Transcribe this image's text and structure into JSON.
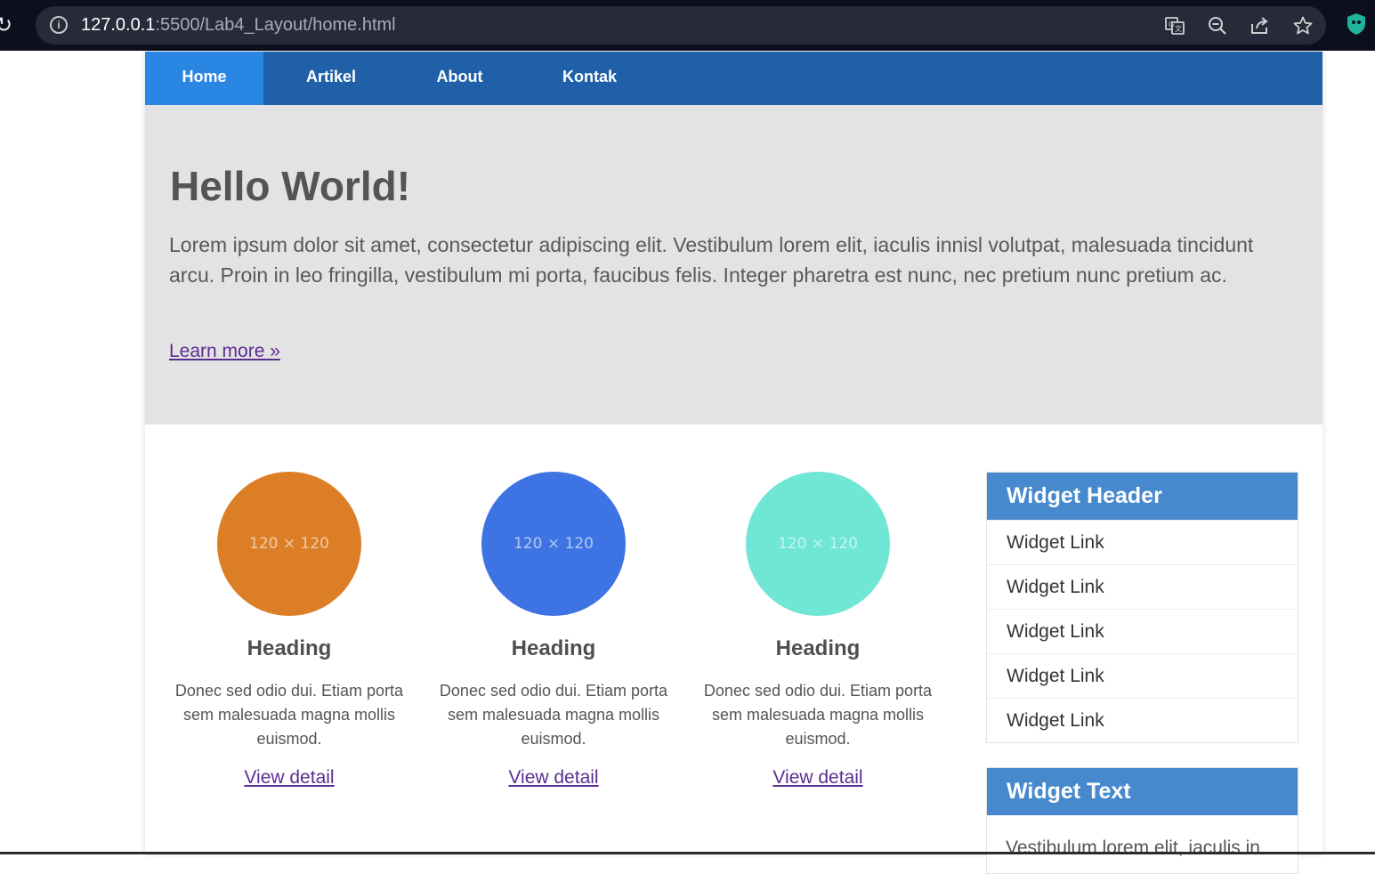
{
  "browser": {
    "url_host": "127.0.0.1",
    "url_path": ":5500/Lab4_Layout/home.html",
    "icons": [
      "reload-icon",
      "info-icon",
      "translate-icon",
      "zoom-out-icon",
      "share-icon",
      "star-icon",
      "extension-icon"
    ]
  },
  "nav": {
    "items": [
      {
        "label": "Home",
        "active": true
      },
      {
        "label": "Artikel",
        "active": false
      },
      {
        "label": "About",
        "active": false
      },
      {
        "label": "Kontak",
        "active": false
      }
    ],
    "colors": {
      "bar": "#1f60a8",
      "active": "#2a86e3"
    }
  },
  "hero": {
    "title": "Hello World!",
    "text": "Lorem ipsum dolor sit amet, consectetur adipiscing elit. Vestibulum lorem elit, iaculis innisl volutpat, malesuada tincidunt arcu. Proin in leo fringilla, vestibulum mi porta, faucibus felis. Integer pharetra est nunc, nec pretium nunc pretium ac.",
    "link": "Learn more »"
  },
  "cards": [
    {
      "placeholder": "120 × 120",
      "color": "#dc7e26",
      "heading": "Heading",
      "text": "Donec sed odio dui. Etiam porta sem malesuada magna mollis euismod.",
      "link": "View detail"
    },
    {
      "placeholder": "120 × 120",
      "color": "#3e73e3",
      "heading": "Heading",
      "text": "Donec sed odio dui. Etiam porta sem malesuada magna mollis euismod.",
      "link": "View detail"
    },
    {
      "placeholder": "120 × 120",
      "color": "#70e6d5",
      "heading": "Heading",
      "text": "Donec sed odio dui. Etiam porta sem malesuada magna mollis euismod.",
      "link": "View detail"
    }
  ],
  "widget_links": {
    "header": "Widget Header",
    "links": [
      "Widget Link",
      "Widget Link",
      "Widget Link",
      "Widget Link",
      "Widget Link"
    ]
  },
  "widget_text": {
    "header": "Widget Text",
    "body": "Vestibulum lorem elit, iaculis in"
  }
}
